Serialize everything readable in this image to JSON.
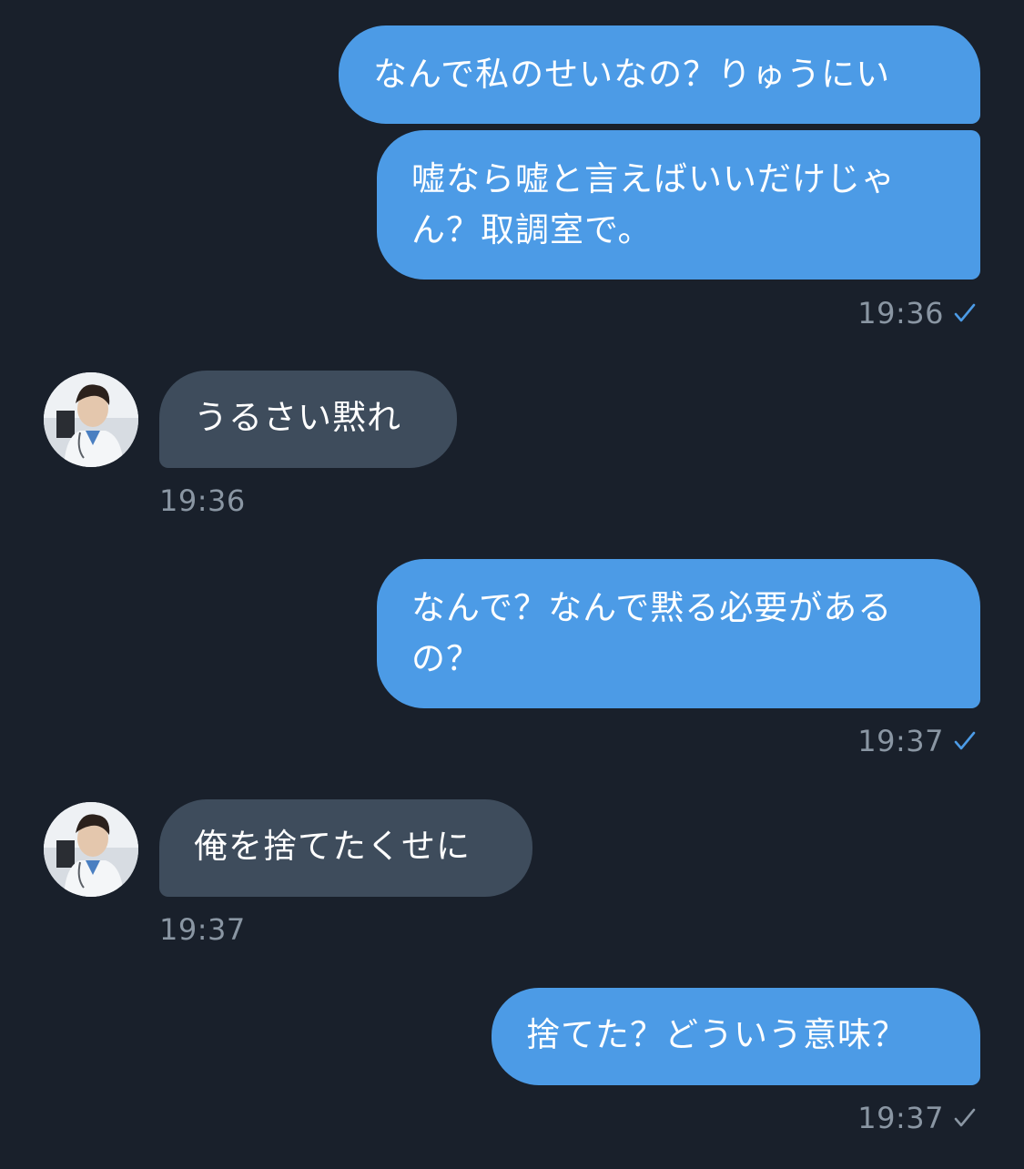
{
  "colors": {
    "background": "#19202b",
    "outgoing_bubble": "#4c9be6",
    "incoming_bubble": "#3e4c5c",
    "timestamp": "#8a96a3",
    "check_sent": "#4c9be6",
    "check_pending": "#8a96a3"
  },
  "messages": [
    {
      "direction": "outgoing",
      "text": "なんで私のせいなの？りゅうにい"
    },
    {
      "direction": "outgoing",
      "text": "嘘なら嘘と言えばいいだけじゃん？取調室で。",
      "time": "19:36",
      "status_icon": "check-icon"
    },
    {
      "direction": "incoming",
      "text": "うるさい黙れ",
      "time": "19:36",
      "avatar_icon": "doctor-avatar"
    },
    {
      "direction": "outgoing",
      "text": "なんで？なんで黙る必要があるの？",
      "time": "19:37",
      "status_icon": "check-icon"
    },
    {
      "direction": "incoming",
      "text": "俺を捨てたくせに",
      "time": "19:37",
      "avatar_icon": "doctor-avatar"
    },
    {
      "direction": "outgoing",
      "text": "捨てた？どういう意味？",
      "time": "19:37",
      "status_icon": "check-icon"
    }
  ]
}
